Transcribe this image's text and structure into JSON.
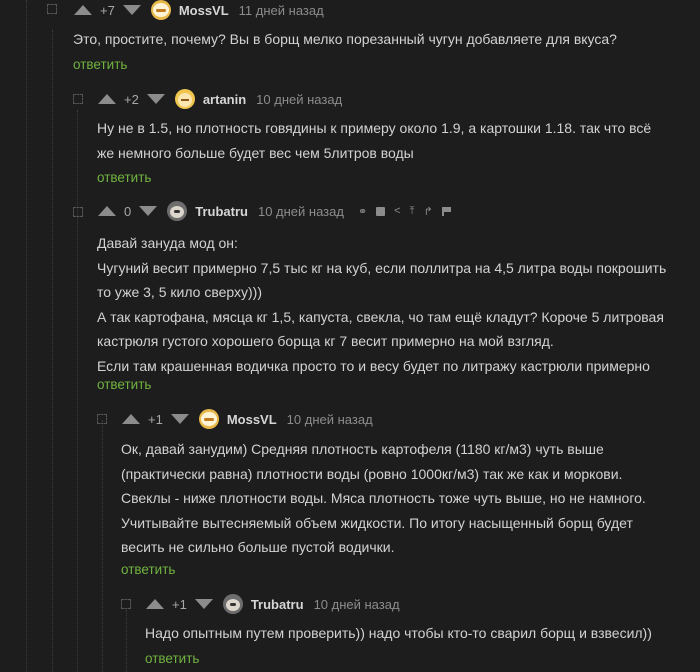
{
  "comments": [
    {
      "rating": "+7",
      "author": "MossVL",
      "time": "11 дней назад",
      "lines": [
        "Это, простите, почему? Вы в борщ мелко порезанный чугун добавляете для вкуса?"
      ],
      "reply": "ответить"
    },
    {
      "rating": "+2",
      "author": "artanin",
      "time": "10 дней назад",
      "lines": [
        "Ну не в 1.5, но плотность говядины к примеру около 1.9, а картошки 1.18. так что всё",
        "же немного больше будет вес чем 5литров воды"
      ],
      "reply": "ответить"
    },
    {
      "rating": "0",
      "author": "Trubatru",
      "time": "10 дней назад",
      "tools": [
        "link-icon",
        "save-icon",
        "share-icon",
        "up-branch-icon",
        "branch-icon",
        "flag-icon"
      ],
      "lines": [
        "Давай зануда мод он:",
        "Чугуний весит примерно 7,5 тыс кг на куб, если поллитра на 4,5 литра воды покрошить",
        "то уже 3, 5 кило сверху)))",
        "А так картофана, мясца кг 1,5, капуста, свекла, чо там ещё кладут? Короче 5 литровая",
        "кастрюля густого хорошего борща кг 7 весит примерно на мой взгляд.",
        "Если там крашенная водичка просто то и весу будет по литражу кастрюли примерно"
      ],
      "reply": "ответить"
    },
    {
      "rating": "+1",
      "author": "MossVL",
      "time": "10 дней назад",
      "lines": [
        "Ок, давай занудим) Средняя плотность картофеля (1180 кг/м3) чуть выше",
        "(практически равна) плотности воды (ровно 1000кг/м3) так же как и моркови.",
        "Свеклы - ниже плотности воды. Мяса плотность тоже чуть выше, но не намного.",
        "Учитывайте вытесняемый объем жидкости. По итогу насыщенный борщ будет",
        "весить не сильно больше пустой водички."
      ],
      "reply": "ответить"
    },
    {
      "rating": "+1",
      "author": "Trubatru",
      "time": "10 дней назад",
      "lines": [
        "Надо опытным путем проверить)) надо чтобы кто-то сварил борщ и взвесил))"
      ],
      "reply": "ответить"
    }
  ]
}
